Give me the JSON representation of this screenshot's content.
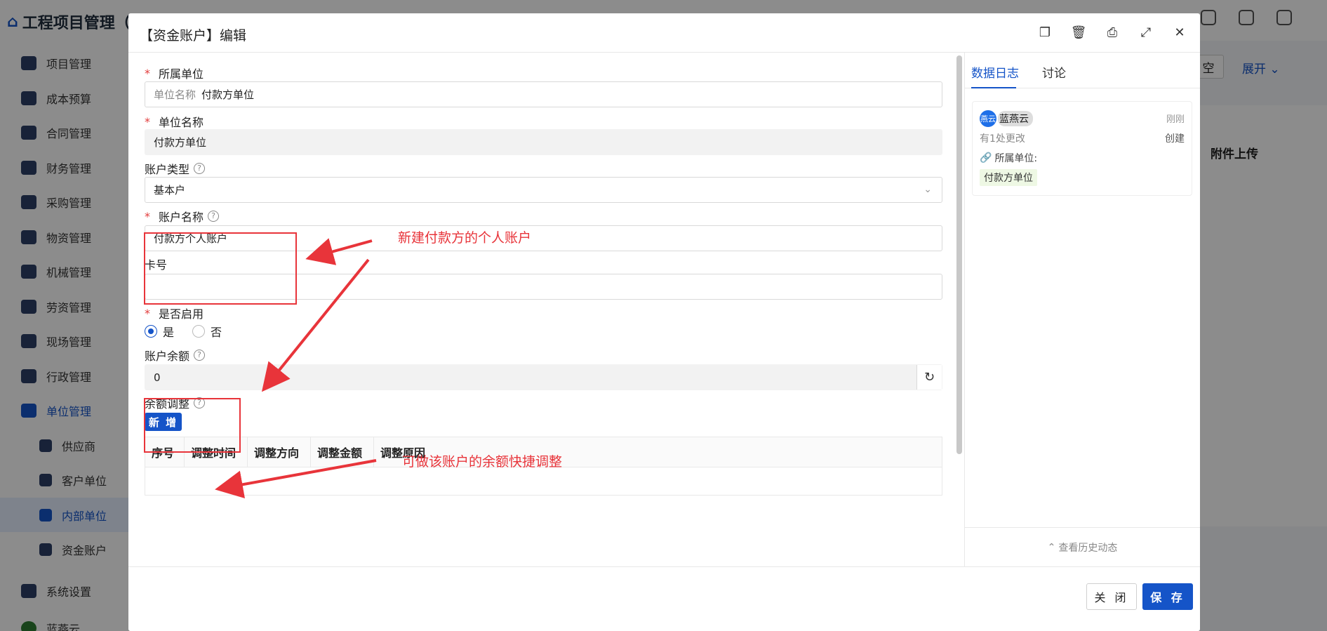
{
  "app": {
    "title": "工程项目管理（市",
    "expand_label": "展开",
    "clear_label": "空",
    "attach_header": "附件上传"
  },
  "sidebar": {
    "items": [
      {
        "label": "项目管理"
      },
      {
        "label": "成本预算"
      },
      {
        "label": "合同管理"
      },
      {
        "label": "财务管理"
      },
      {
        "label": "采购管理"
      },
      {
        "label": "物资管理"
      },
      {
        "label": "机械管理"
      },
      {
        "label": "劳资管理"
      },
      {
        "label": "现场管理"
      },
      {
        "label": "行政管理"
      },
      {
        "label": "单位管理"
      },
      {
        "label": "供应商"
      },
      {
        "label": "客户单位"
      },
      {
        "label": "内部单位"
      },
      {
        "label": "资金账户"
      },
      {
        "label": "系统设置"
      },
      {
        "label": "蓝燕云"
      }
    ]
  },
  "modal": {
    "title": "【资金账户】编辑",
    "fields": {
      "unit": {
        "label": "所属单位",
        "prefix": "单位名称",
        "value": "付款方单位"
      },
      "unit_name": {
        "label": "单位名称",
        "value": "付款方单位"
      },
      "account_type": {
        "label": "账户类型",
        "value": "基本户"
      },
      "account_name": {
        "label": "账户名称",
        "value": "付款方个人账户"
      },
      "card_no": {
        "label": "卡号",
        "value": ""
      },
      "enabled": {
        "label": "是否启用",
        "yes": "是",
        "no": "否",
        "selected": "是"
      },
      "balance": {
        "label": "账户余额",
        "value": "0"
      },
      "adjust": {
        "label": "余额调整",
        "add_button": "新 增"
      }
    },
    "table": {
      "columns": [
        "序号",
        "调整时间",
        "调整方向",
        "调整金额",
        "调整原因"
      ]
    },
    "annotations": {
      "note1": "新建付款方的个人账户",
      "note2": "可做该账户的余额快捷调整"
    },
    "side": {
      "tabs": [
        "数据日志",
        "讨论"
      ],
      "log": {
        "avatar": "燕云",
        "user": "蓝燕云",
        "time": "刚刚",
        "changes": "有1处更改",
        "action": "创建",
        "field": "所属单位:",
        "value": "付款方单位"
      },
      "history": "查看历史动态"
    },
    "footer": {
      "close": "关 闭",
      "save": "保 存"
    }
  }
}
